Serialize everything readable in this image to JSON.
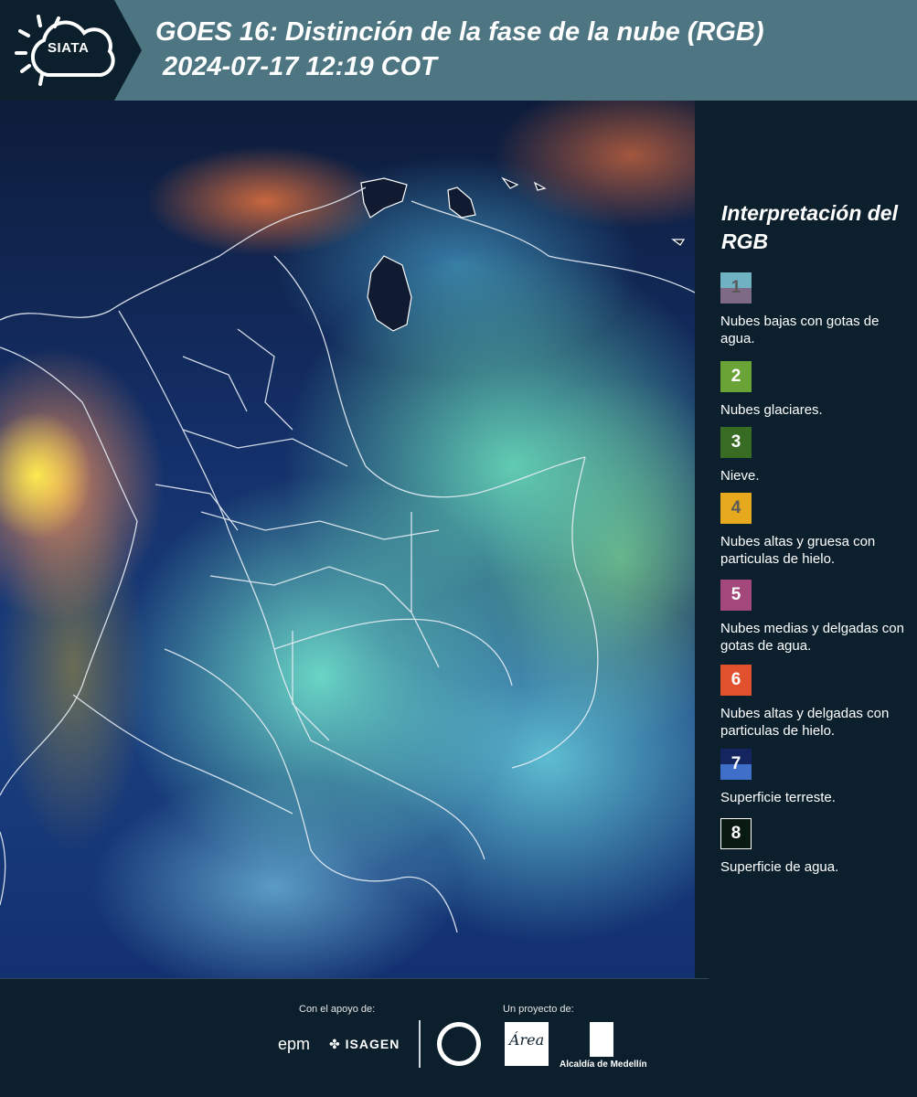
{
  "header": {
    "logo_text": "SIATA",
    "title": "GOES 16: Distinción de la fase de la nube (RGB)",
    "subtitle": "2024-07-17 12:19 COT",
    "background_color": "#4d7582"
  },
  "map": {
    "image_description_icon": "satellite-rgb-map"
  },
  "legend": {
    "title": "Interpretación del RGB",
    "items": [
      {
        "number": "1",
        "label": "Nubes bajas con gotas de agua.",
        "color_top": "#6fb2c2",
        "color_bottom": "#7e6a86",
        "text_color": "#5a5a5a"
      },
      {
        "number": "2",
        "label": "Nubes glaciares.",
        "color_top": "#6aa336",
        "color_bottom": "#6aa336",
        "text_color": "#ffffff"
      },
      {
        "number": "3",
        "label": "Nieve.",
        "color_top": "#386b23",
        "color_bottom": "#386b23",
        "text_color": "#ffffff"
      },
      {
        "number": "4",
        "label": "Nubes altas y gruesa con particulas de hielo.",
        "color_top": "#e6a91d",
        "color_bottom": "#e6a91d",
        "text_color": "#5a5a5a"
      },
      {
        "number": "5",
        "label": "Nubes medias y delgadas con gotas de agua.",
        "color_top": "#a4487b",
        "color_bottom": "#a4487b",
        "text_color": "#ffffff"
      },
      {
        "number": "6",
        "label": "Nubes altas y delgadas con particulas de hielo.",
        "color_top": "#e2512d",
        "color_bottom": "#e2512d",
        "text_color": "#ffffff"
      },
      {
        "number": "7",
        "label": "Superficie terreste.",
        "color_top": "#15255f",
        "color_bottom": "#3f6fc8",
        "text_color": "#ffffff"
      },
      {
        "number": "8",
        "label": "Superficie de agua.",
        "color_top": "#091a12",
        "color_bottom": "#091a12",
        "text_color": "#ffffff"
      }
    ]
  },
  "footer": {
    "support_label": "Con el apoyo de:",
    "project_label": "Un proyecto de:",
    "epm": "epm",
    "isagen": "ISAGEN",
    "area_logo": "Área",
    "alcaldia": "Alcaldía de Medellín"
  }
}
